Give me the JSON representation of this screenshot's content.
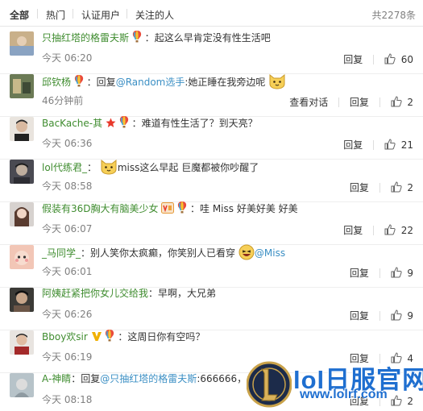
{
  "tabs": [
    {
      "label": "全部",
      "active": true
    },
    {
      "label": "热门",
      "active": false
    },
    {
      "label": "认证用户",
      "active": false
    },
    {
      "label": "关注的人",
      "active": false
    }
  ],
  "total": "共2278条",
  "reply_label": "回复",
  "view_conversation_label": "查看对话",
  "comments": [
    {
      "username": "只抽红塔的格雷夫斯",
      "badges": [
        "hot-air-balloon-icon"
      ],
      "prefix": "：",
      "text": "起这么早肯定没有性生活吧",
      "time": "今天 06:20",
      "likes": "60",
      "avatar_color": "#c9b08a"
    },
    {
      "username": "邱钦杨",
      "badges": [
        "hot-air-balloon-icon"
      ],
      "prefix": "：回复",
      "mention": "@Random选手",
      "text": ":她正睡在我旁边呢",
      "emoji": "cat-face-icon",
      "time": "46分钟前",
      "likes": "2",
      "avatar_color": "#6b7a55",
      "show_conversation": true
    },
    {
      "username": "BacKache-其",
      "badges": [
        "star-badge-icon",
        "hot-air-balloon-icon"
      ],
      "prefix": "：",
      "text": "难道有性生活了？到天亮？",
      "time": "今天 06:36",
      "likes": "21",
      "avatar_color": "#d9cdbf"
    },
    {
      "username": "lol代练君_",
      "badges": [],
      "prefix": "：",
      "emoji_before": "cat-face-icon",
      "text": "miss这么早起 巨魔都被你吵醒了",
      "time": "今天 08:58",
      "likes": "2",
      "avatar_color": "#4a4a52"
    },
    {
      "username": "假装有36D胸大有脑美少女",
      "badges": [
        "vip-badge-icon",
        "hot-air-balloon-icon"
      ],
      "prefix": "：",
      "text": "哇 Miss 好美好美 好美",
      "time": "今天 06:07",
      "likes": "22",
      "avatar_color": "#e2c3b4"
    },
    {
      "username": "_马同学_",
      "badges": [],
      "prefix": "：",
      "text": "别人笑你太疯癫，你笑别人已看穿",
      "emoji": "laughing-face-icon",
      "mention": "@Miss",
      "time": "今天 06:01",
      "likes": "9",
      "avatar_color": "#e8a9a0"
    },
    {
      "username": "阿姨赶紧把你女儿交给我",
      "badges": [],
      "prefix": "：",
      "text": "早啊，大兄弟",
      "time": "今天 06:26",
      "likes": "9",
      "avatar_color": "#6a5a4e"
    },
    {
      "username": "Bboy欢sir",
      "badges": [
        "v-badge-icon",
        "hot-air-balloon-icon"
      ],
      "prefix": "：",
      "text": "这周日你有空吗？",
      "time": "今天 06:19",
      "likes": "4",
      "avatar_color": "#cfc7bf"
    },
    {
      "username": "A-神睛",
      "badges": [],
      "prefix": "：回复",
      "mention": "@只抽红塔的格雷夫斯",
      "text": ":666666，m",
      "time": "今天 08:18",
      "likes": "2",
      "avatar_color": "#b7c3c9"
    }
  ],
  "watermark": {
    "title": "lol日服官网",
    "url": "www.lolrf.com"
  },
  "colors": {
    "username": "#3f8c2f",
    "mention": "#3b8fc4",
    "muted": "#808080",
    "watermark": "#1f6fd0"
  }
}
